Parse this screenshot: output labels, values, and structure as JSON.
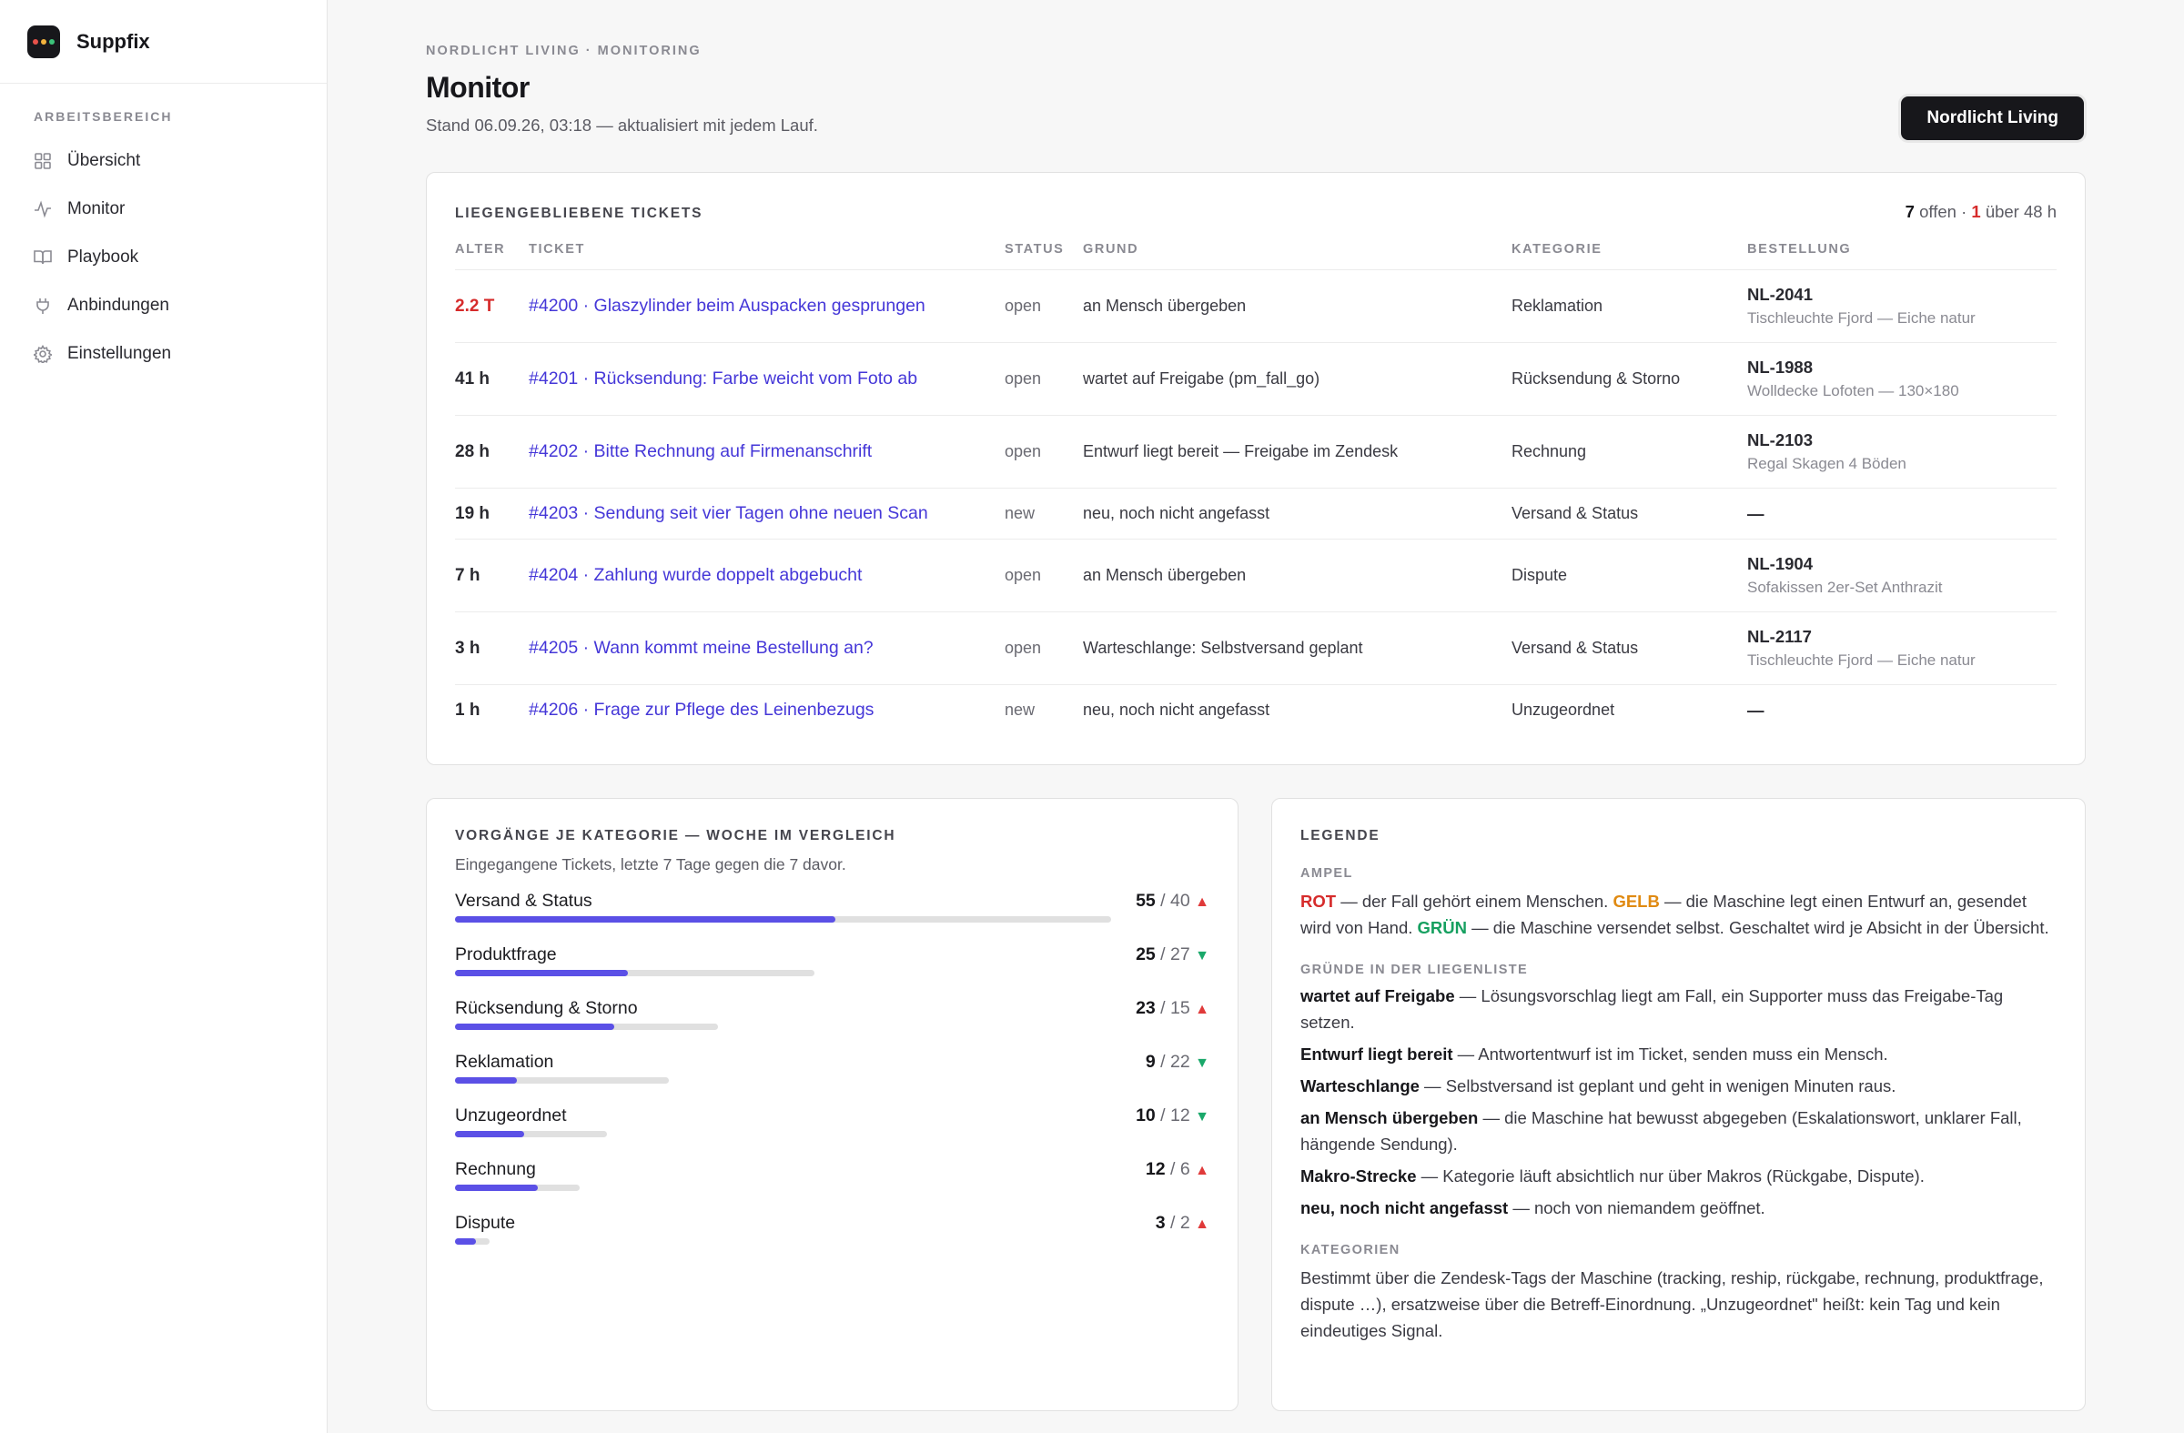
{
  "brand": {
    "name": "Suppfix",
    "dot_colors": [
      "#e8524a",
      "#f2b33d",
      "#3cc27a"
    ]
  },
  "sidebar": {
    "section_title": "ARBEITSBEREICH",
    "items": [
      {
        "label": "Übersicht",
        "icon": "grid-icon"
      },
      {
        "label": "Monitor",
        "icon": "activity-icon"
      },
      {
        "label": "Playbook",
        "icon": "book-icon"
      },
      {
        "label": "Anbindungen",
        "icon": "plug-icon"
      },
      {
        "label": "Einstellungen",
        "icon": "gear-icon"
      }
    ]
  },
  "header": {
    "eyebrow": "NORDLICHT LIVING · MONITORING",
    "title": "Monitor",
    "subtitle": "Stand 06.09.26, 03:18 — aktualisiert mit jedem Lauf.",
    "client_button": "Nordlicht Living"
  },
  "tickets": {
    "title": "LIEGENGEBLIEBENE TICKETS",
    "summary": {
      "open_count": "7",
      "open_label": "offen",
      "sep": "·",
      "over_count": "1",
      "over_label": "über 48 h"
    },
    "columns": [
      "ALTER",
      "TICKET",
      "STATUS",
      "GRUND",
      "KATEGORIE",
      "BESTELLUNG"
    ],
    "rows": [
      {
        "age": "2.2 T",
        "warn": true,
        "ticket": "#4200 · Glaszylinder beim Auspacken gesprungen",
        "status": "open",
        "reason": "an Mensch übergeben",
        "category": "Reklamation",
        "order_id": "NL-2041",
        "order_item": "Tischleuchte Fjord — Eiche natur"
      },
      {
        "age": "41 h",
        "warn": false,
        "ticket": "#4201 · Rücksendung: Farbe weicht vom Foto ab",
        "status": "open",
        "reason": "wartet auf Freigabe (pm_fall_go)",
        "category": "Rücksendung & Storno",
        "order_id": "NL-1988",
        "order_item": "Wolldecke Lofoten — 130×180"
      },
      {
        "age": "28 h",
        "warn": false,
        "ticket": "#4202 · Bitte Rechnung auf Firmenanschrift",
        "status": "open",
        "reason": "Entwurf liegt bereit — Freigabe im Zendesk",
        "category": "Rechnung",
        "order_id": "NL-2103",
        "order_item": "Regal Skagen 4 Böden"
      },
      {
        "age": "19 h",
        "warn": false,
        "ticket": "#4203 · Sendung seit vier Tagen ohne neuen Scan",
        "status": "new",
        "reason": "neu, noch nicht angefasst",
        "category": "Versand & Status",
        "order_id": "—",
        "order_item": ""
      },
      {
        "age": "7 h",
        "warn": false,
        "ticket": "#4204 · Zahlung wurde doppelt abgebucht",
        "status": "open",
        "reason": "an Mensch übergeben",
        "category": "Dispute",
        "order_id": "NL-1904",
        "order_item": "Sofakissen 2er-Set Anthrazit"
      },
      {
        "age": "3 h",
        "warn": false,
        "ticket": "#4205 · Wann kommt meine Bestellung an?",
        "status": "open",
        "reason": "Warteschlange: Selbstversand geplant",
        "category": "Versand & Status",
        "order_id": "NL-2117",
        "order_item": "Tischleuchte Fjord — Eiche natur"
      },
      {
        "age": "1 h",
        "warn": false,
        "ticket": "#4206 · Frage zur Pflege des Leinenbezugs",
        "status": "new",
        "reason": "neu, noch nicht angefasst",
        "category": "Unzugeordnet",
        "order_id": "—",
        "order_item": ""
      }
    ]
  },
  "categories_card": {
    "title": "VORGÄNGE JE KATEGORIE — WOCHE IM VERGLEICH",
    "subtitle": "Eingegangene Tickets, letzte 7 Tage gegen die 7 davor.",
    "max_value": 55,
    "rows": [
      {
        "label": "Versand & Status",
        "current": 55,
        "previous": 40,
        "trend": "up"
      },
      {
        "label": "Produktfrage",
        "current": 25,
        "previous": 27,
        "trend": "down"
      },
      {
        "label": "Rücksendung & Storno",
        "current": 23,
        "previous": 15,
        "trend": "up"
      },
      {
        "label": "Reklamation",
        "current": 9,
        "previous": 22,
        "trend": "down"
      },
      {
        "label": "Unzugeordnet",
        "current": 10,
        "previous": 12,
        "trend": "down"
      },
      {
        "label": "Rechnung",
        "current": 12,
        "previous": 6,
        "trend": "up"
      },
      {
        "label": "Dispute",
        "current": 3,
        "previous": 2,
        "trend": "up"
      }
    ],
    "colors": {
      "bar": "#5b50e6",
      "track": "#e0e0e0",
      "up": "#e03a3a",
      "down": "#1aa86a"
    }
  },
  "legend": {
    "title": "LEGENDE",
    "ampel_title": "AMPEL",
    "ampel": {
      "red": "ROT",
      "red_text": " — der Fall gehört einem Menschen. ",
      "yellow": "GELB",
      "yellow_text": " — die Maschine legt einen Entwurf an, gesendet wird von Hand. ",
      "green": "GRÜN",
      "green_text": " — die Maschine versendet selbst. Geschaltet wird je Absicht in der Übersicht."
    },
    "reasons_title": "GRÜNDE IN DER LIEGENLISTE",
    "reasons": [
      {
        "term": "wartet auf Freigabe",
        "text": " — Lösungsvorschlag liegt am Fall, ein Supporter muss das Freigabe-Tag setzen."
      },
      {
        "term": "Entwurf liegt bereit",
        "text": " — Antwortentwurf ist im Ticket, senden muss ein Mensch."
      },
      {
        "term": "Warteschlange",
        "text": " — Selbstversand ist geplant und geht in wenigen Minuten raus."
      },
      {
        "term": "an Mensch übergeben",
        "text": " — die Maschine hat bewusst abgegeben (Eskalationswort, unklarer Fall, hängende Sendung)."
      },
      {
        "term": "Makro-Strecke",
        "text": " — Kategorie läuft absichtlich nur über Makros (Rückgabe, Dispute)."
      },
      {
        "term": "neu, noch nicht angefasst",
        "text": " — noch von niemandem geöffnet."
      }
    ],
    "categories_title": "KATEGORIEN",
    "categories_text": "Bestimmt über die Zendesk-Tags der Maschine (tracking, reship, rückgabe, rechnung, produktfrage, dispute …), ersatzweise über die Betreff-Einordnung. „Unzugeordnet\" heißt: kein Tag und kein eindeutiges Signal."
  }
}
